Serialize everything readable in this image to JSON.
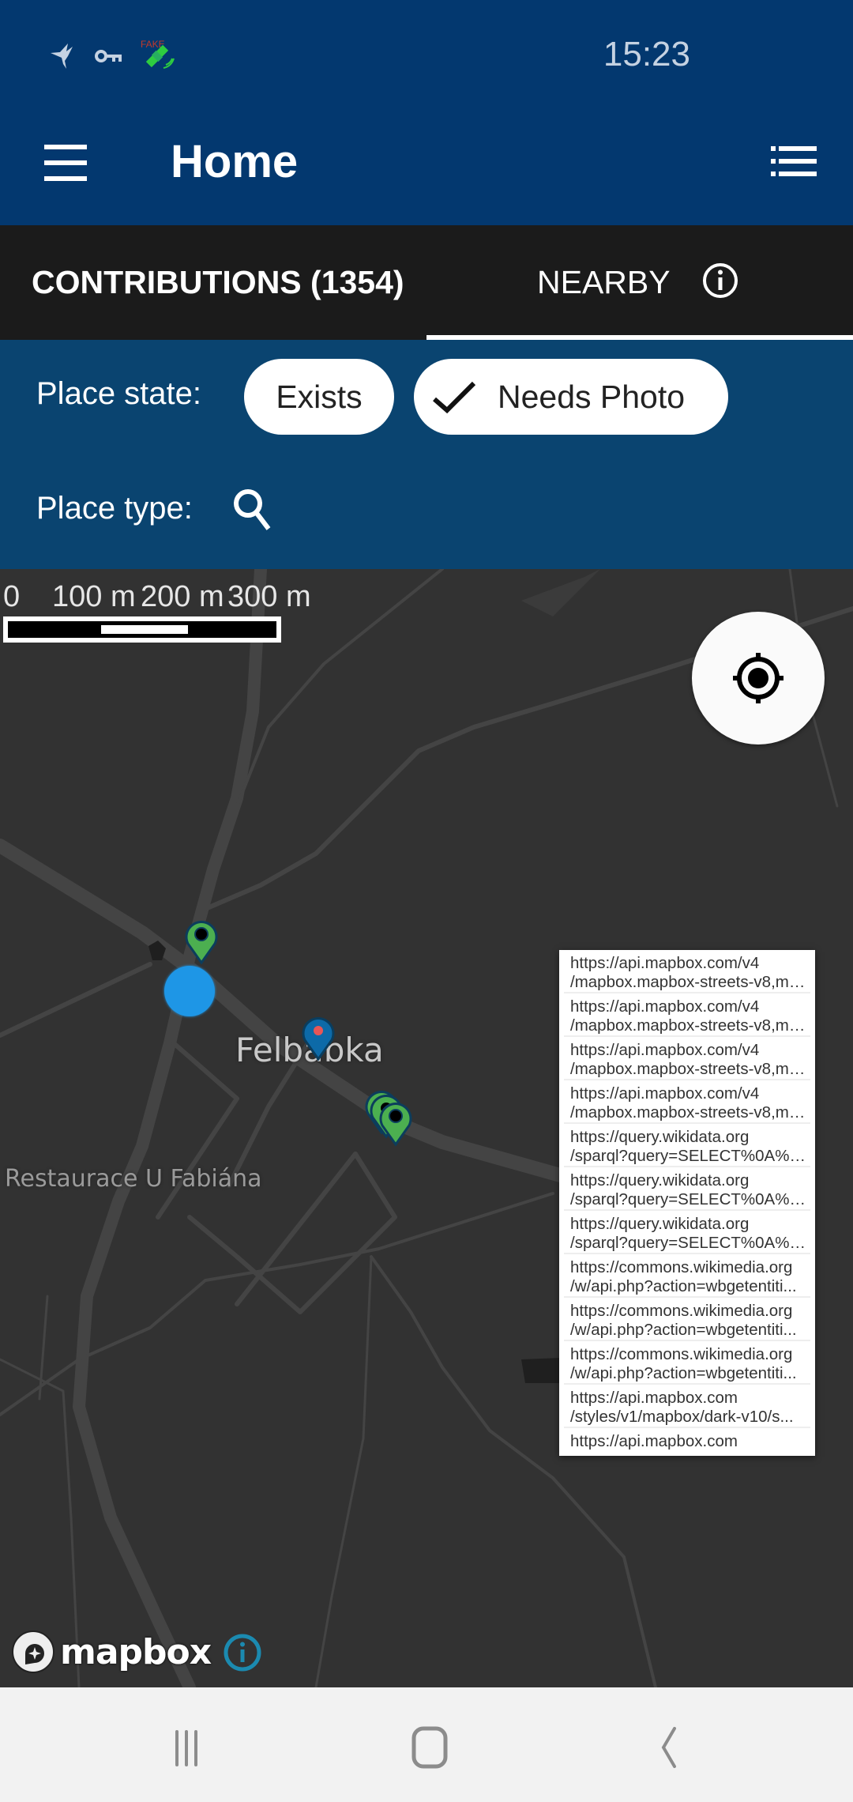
{
  "status_bar": {
    "time": "15:23",
    "icons": [
      "hummingbird-icon",
      "vpn-key-icon",
      "fake-gps-satellite-icon"
    ],
    "fake_label": "FAKE"
  },
  "app_bar": {
    "title": "Home",
    "menu_icon": "hamburger-menu-icon",
    "list_icon": "list-view-icon"
  },
  "tabs": [
    {
      "label": "CONTRIBUTIONS (1354)",
      "selected": false
    },
    {
      "label": "NEARBY",
      "selected": true
    }
  ],
  "filters": {
    "place_state_label": "Place state:",
    "chips": [
      {
        "label": "Exists",
        "checked": false
      },
      {
        "label": "Needs Photo",
        "checked": true
      }
    ],
    "place_type_label": "Place type:"
  },
  "map": {
    "scale_labels": [
      "0",
      "100 m",
      "200 m",
      "300 m"
    ],
    "place_labels": {
      "village": "Felbabka",
      "restaurant": "Restaurace U Fabiána"
    },
    "colors": {
      "background": "#323232",
      "road": "#484848",
      "pin_needs_photo": "#4caf50",
      "pin_selected": "#0d6aa8",
      "user_location": "#1e96e6"
    },
    "attribution": "mapbox"
  },
  "url_list": [
    {
      "line1": "https://api.mapbox.com/v4",
      "line2": "/mapbox.mapbox-streets-v8,ma..."
    },
    {
      "line1": "https://api.mapbox.com/v4",
      "line2": "/mapbox.mapbox-streets-v8,ma..."
    },
    {
      "line1": "https://api.mapbox.com/v4",
      "line2": "/mapbox.mapbox-streets-v8,ma..."
    },
    {
      "line1": "https://api.mapbox.com/v4",
      "line2": "/mapbox.mapbox-streets-v8,ma..."
    },
    {
      "line1": "https://query.wikidata.org",
      "line2": "/sparql?query=SELECT%0A%20..."
    },
    {
      "line1": "https://query.wikidata.org",
      "line2": "/sparql?query=SELECT%0A%20..."
    },
    {
      "line1": "https://query.wikidata.org",
      "line2": "/sparql?query=SELECT%0A%20..."
    },
    {
      "line1": "https://commons.wikimedia.org",
      "line2": "/w/api.php?action=wbgetentiti..."
    },
    {
      "line1": "https://commons.wikimedia.org",
      "line2": "/w/api.php?action=wbgetentiti..."
    },
    {
      "line1": "https://commons.wikimedia.org",
      "line2": "/w/api.php?action=wbgetentiti..."
    },
    {
      "line1": "https://api.mapbox.com",
      "line2": "/styles/v1/mapbox/dark-v10/s..."
    },
    {
      "line1": "https://api.mapbox.com",
      "line2": ""
    }
  ],
  "nav_bar": {
    "buttons": [
      "recent-apps",
      "home",
      "back"
    ]
  }
}
